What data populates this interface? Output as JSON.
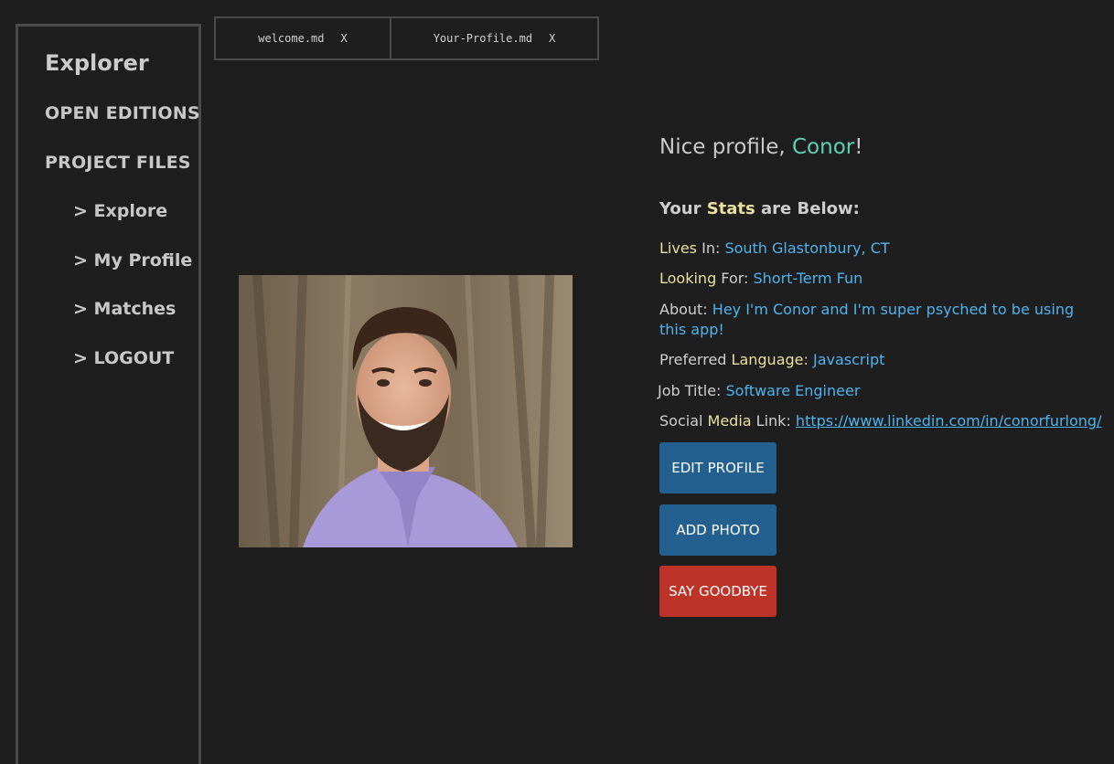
{
  "sidebar": {
    "title": "Explorer",
    "sections": [
      "OPEN EDITIONS",
      "PROJECT FILES"
    ],
    "items": [
      {
        "label": "> Explore"
      },
      {
        "label": "> My Profile"
      },
      {
        "label": "> Matches"
      },
      {
        "label": "> LOGOUT"
      }
    ]
  },
  "tabs": [
    {
      "label": "welcome.md",
      "close": "X"
    },
    {
      "label": "Your-Profile.md",
      "close": "X"
    }
  ],
  "profile": {
    "greeting_prefix": "Nice profile, ",
    "name": "Conor",
    "greeting_suffix": "!",
    "stats_heading": {
      "pre": "Your ",
      "highlight": "Stats",
      "post": " are Below:"
    },
    "lives": {
      "kw": "Lives",
      "rest": " In: ",
      "value": "South Glastonbury, CT"
    },
    "looking": {
      "kw": "Looking",
      "rest": " For: ",
      "value": "Short-Term Fun"
    },
    "about": {
      "label": "About: ",
      "value": "Hey I'm Conor and I'm super psyched to be using this app!"
    },
    "language": {
      "pre": "Preferred ",
      "kw": "Language",
      "rest": ": ",
      "value": "Javascript"
    },
    "job": {
      "label": "Job Title: ",
      "value": "Software Engineer"
    },
    "social": {
      "pre": "Social ",
      "kw": "Media",
      "rest": " Link: ",
      "value": "https://www.linkedin.com/in/conorfurlong/"
    }
  },
  "buttons": {
    "edit": "EDIT PROFILE",
    "add_photo": "ADD PHOTO",
    "goodbye": "SAY GOODBYE"
  },
  "colors": {
    "background": "#1e1e1e",
    "accent_name": "#5fd0b4",
    "keyword": "#e8e0a0",
    "value": "#4fb3ee",
    "button_blue": "#23608f",
    "button_red": "#be3328"
  }
}
